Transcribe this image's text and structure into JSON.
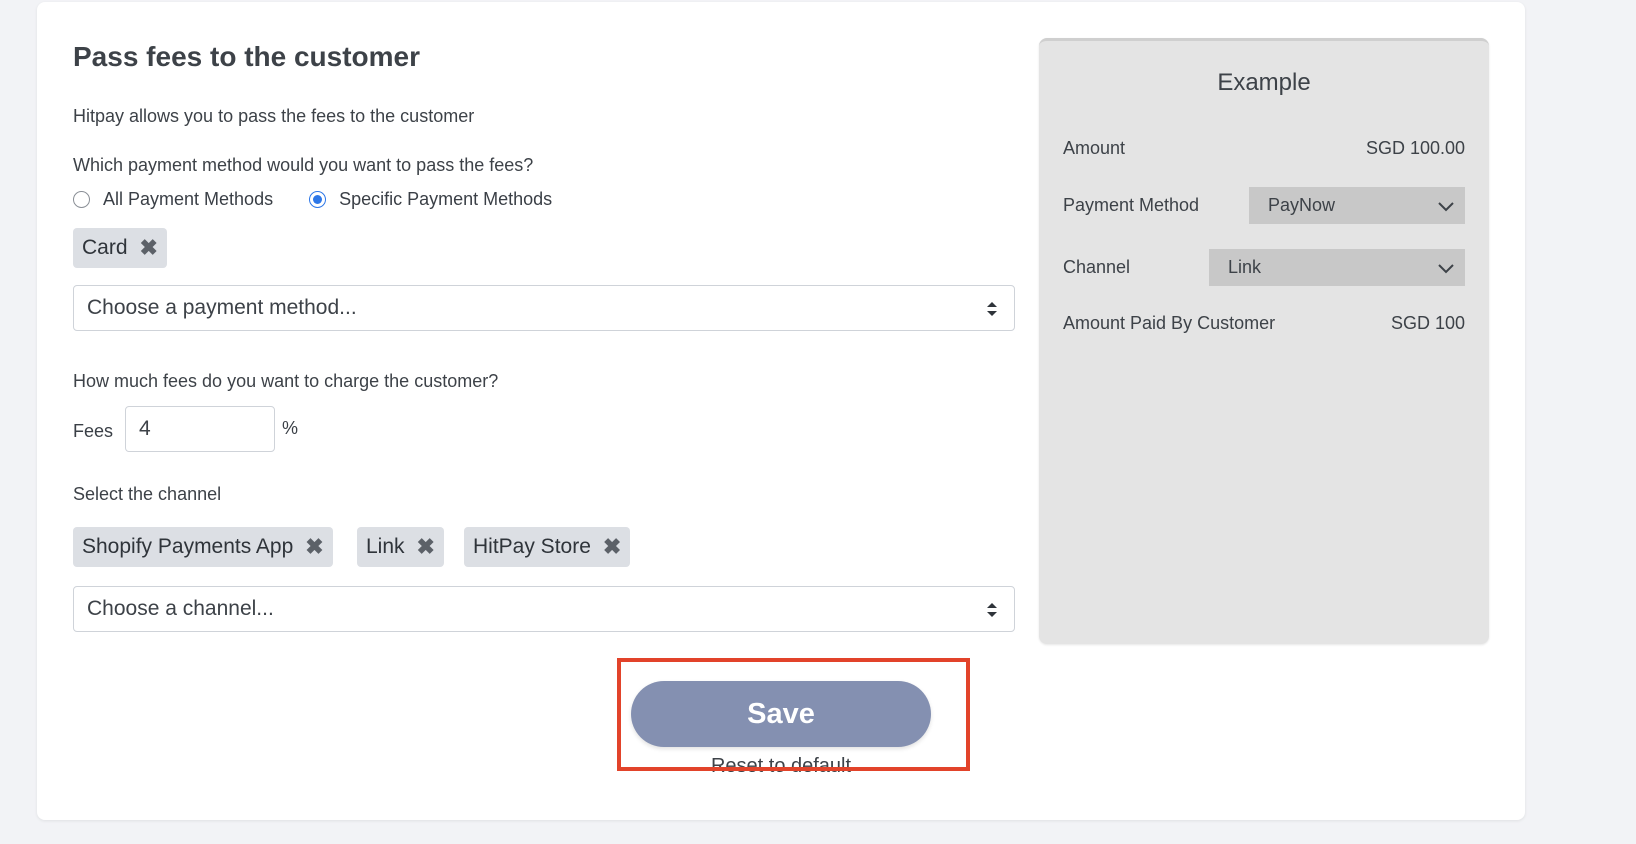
{
  "form": {
    "title": "Pass fees to the customer",
    "subtitle": "Hitpay allows you to pass the fees to the customer",
    "method_question": "Which payment method would you want to pass the fees?",
    "radio_options": [
      {
        "label": "All Payment Methods",
        "checked": false
      },
      {
        "label": "Specific Payment Methods",
        "checked": true
      }
    ],
    "payment_tags": [
      "Card"
    ],
    "payment_placeholder": "Choose a payment method...",
    "fees_question": "How much fees do you want to charge the customer?",
    "fees_label": "Fees",
    "fees_value": "4",
    "fees_unit": "%",
    "channel_question": "Select the channel",
    "channel_tags": [
      "Shopify Payments App",
      "Link",
      "HitPay Store"
    ],
    "channel_placeholder": "Choose a channel...",
    "save_label": "Save",
    "reset_label": "Reset to default"
  },
  "example": {
    "title": "Example",
    "amount_label": "Amount",
    "amount_value": "SGD 100.00",
    "payment_method_label": "Payment Method",
    "payment_method_value": "PayNow",
    "channel_label": "Channel",
    "channel_value": "Link",
    "paid_label": "Amount Paid By Customer",
    "paid_value": "SGD 100"
  },
  "colors": {
    "accent": "#2d77e8",
    "save_button": "#8490b1",
    "highlight": "#e2432a",
    "tag_bg": "#dcdfe4"
  },
  "icons": {
    "tag_remove": "close-x-icon",
    "select_arrows": "sort-arrows-icon",
    "dropdown": "chevron-down-icon"
  }
}
